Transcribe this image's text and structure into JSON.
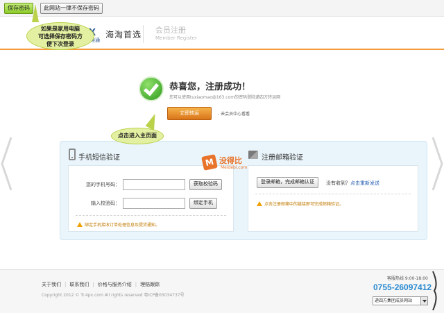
{
  "password_bar": {
    "save_label": "保存密码",
    "never_label": "此网站一律不保存密码"
  },
  "callouts": {
    "top": [
      "如果是家用电脑",
      "可选择保存密码方",
      "便下次登录"
    ],
    "mid": "点击进入主页面"
  },
  "header": {
    "logo_mark": "X",
    "logo_sub": "递通",
    "brand": "海淘首选",
    "section_title": "会员注册",
    "section_title_en": "Member Register"
  },
  "success": {
    "title": "恭喜您，注册成功！",
    "description": "您可以使用tuxiaomao@163.com的密码登陆递四方转运网",
    "go_button": "立即转运",
    "side_link": "去会员中心看看"
  },
  "phone_verify": {
    "title": "手机短信验证",
    "phone_label": "您的手机号码：",
    "phone_value": "",
    "code_label": "输入校验码：",
    "code_value": "",
    "get_code_button": "获取校验码",
    "bind_button": "绑定手机",
    "warning": "绑定手机接收订单处理信息及提货通知。"
  },
  "email_verify": {
    "title": "注册邮箱验证",
    "login_button": "登录邮箱，完成邮箱认证",
    "resend_prefix": "没有收到？",
    "resend_link": "点击重新发送",
    "warning": "点击注册邮箱中的链接即可完成邮箱验证。"
  },
  "watermark": {
    "badge": "M",
    "text": "没得比",
    "sub": "Meidebi.com"
  },
  "footer": {
    "links": [
      "关于我们",
      "联系我们",
      "价格与服务介绍",
      "理赔跟踪"
    ],
    "copyright": "Copyright 2012 © Tr.4px.com All rights reserved 粤ICP备05034737号",
    "hotline_label": "客服热线 9:00-18:00",
    "hotline_number": "0755-26097412",
    "site_select": "递四方集团成员网站"
  },
  "colors": {
    "accent_orange": "#f39c3c",
    "success_green": "#2f9a1e",
    "callout_green": "#e3f0a2",
    "panel_blue": "#eaf5fb",
    "link_blue": "#2a62b5"
  },
  "icons": {
    "success": "check-circle-icon",
    "phone": "mobile-phone-icon",
    "mail": "envelope-icon",
    "warning": "warning-triangle-icon"
  }
}
